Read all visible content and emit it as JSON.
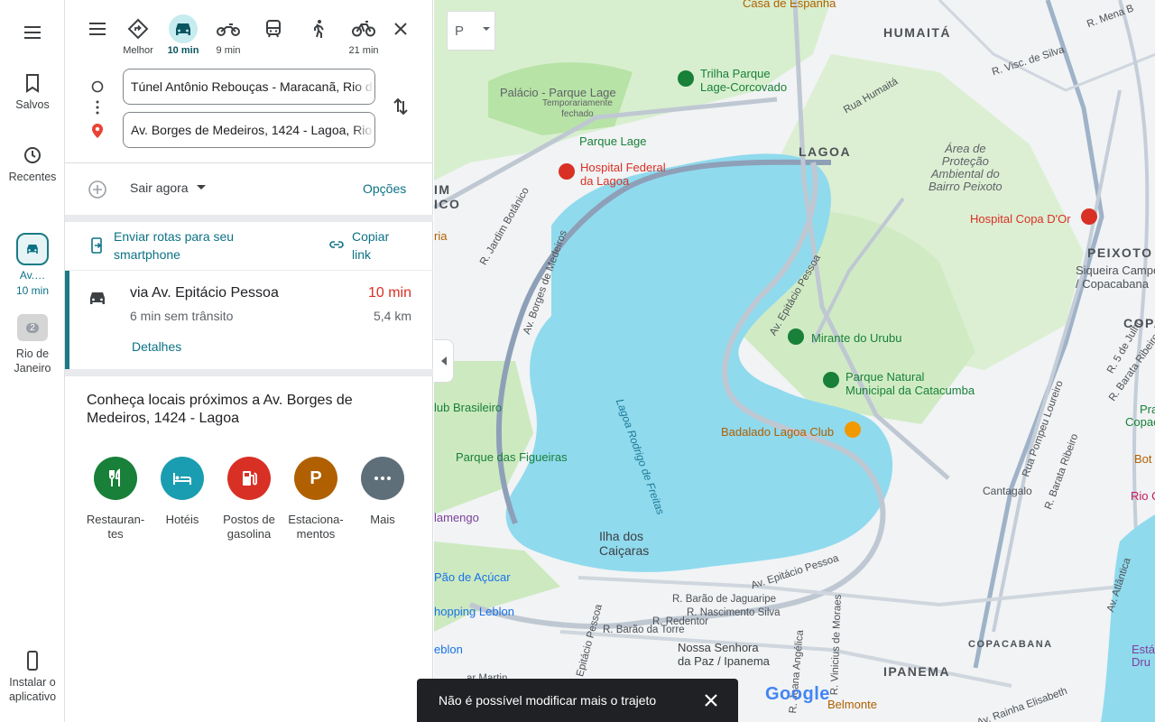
{
  "rail": {
    "saved": "Salvos",
    "recents": "Recentes",
    "route_label": "Av.…",
    "route_time": "10 min",
    "place_label_1": "Rio de",
    "place_label_2": "Janeiro",
    "place_count": "2",
    "install_1": "Instalar o",
    "install_2": "aplicativo"
  },
  "modes": [
    {
      "name": "best",
      "label": "Melhor"
    },
    {
      "name": "car",
      "label": "10 min"
    },
    {
      "name": "moto",
      "label": "9 min"
    },
    {
      "name": "transit",
      "label": ""
    },
    {
      "name": "walk",
      "label": ""
    },
    {
      "name": "bike",
      "label": "21 min"
    }
  ],
  "directions": {
    "origin": "Túnel Antônio Rebouças - Maracanã, Rio de Janeiro",
    "destination": "Av. Borges de Medeiros, 1424 - Lagoa, Rio de Janeiro"
  },
  "leave": {
    "label": "Sair agora",
    "options": "Opções"
  },
  "share": {
    "send_1": "Enviar rotas para seu",
    "send_2": "smartphone",
    "copy_1": "Copiar",
    "copy_2": "link"
  },
  "route": {
    "via": "via Av. Epitácio Pessoa",
    "time": "10 min",
    "traffic": "6 min sem trânsito",
    "distance": "5,4 km",
    "details": "Detalhes"
  },
  "nearby": {
    "title_1": "Conheça locais próximos a Av. Borges de",
    "title_2": "Medeiros, 1424 - Lagoa",
    "categories": [
      {
        "l1": "Restauran-",
        "l2": "tes"
      },
      {
        "l1": "Hotéis",
        "l2": ""
      },
      {
        "l1": "Postos de",
        "l2": "gasolina"
      },
      {
        "l1": "Estaciona-",
        "l2": "mentos"
      },
      {
        "l1": "Mais",
        "l2": ""
      }
    ]
  },
  "map": {
    "layer_label": "P",
    "labels": {
      "humaita": "HUMAITÁ",
      "lagoa": "LAGOA",
      "peixoto": "PEIXOTO",
      "copa": "COPA",
      "copacabana": "COPACABANA",
      "ipanema": "IPANEMA",
      "im": "IM",
      "ico": "ICO",
      "casa": "Casa de Espanha",
      "trilha_1": "Trilha Parque",
      "trilha_2": "Lage-Corcovado",
      "palacio": "Palácio - Parque Lage",
      "temp_1": "Temporariamente",
      "temp_2": "fechado",
      "parque_lage": "Parque Lage",
      "hospital_fed_1": "Hospital Federal",
      "hospital_fed_2": "da Lagoa",
      "area_1": "Área de",
      "area_2": "Proteção",
      "area_3": "Ambiental do",
      "area_4": "Bairro Peixoto",
      "hospital_copa": "Hospital Copa D'Or",
      "siqueira_1": "Siqueira Campos",
      "siqueira_2": "/ Copacabana",
      "mirante": "Mirante do Urubu",
      "parque_natural_1": "Parque Natural",
      "parque_natural_2": "Municipal da Catacumba",
      "badalado": "Badalado Lagoa Club",
      "cantagalo": "Cantagalo",
      "club": "lub Brasileiro",
      "figueiras": "Parque das Figueiras",
      "lagoa_rf": "Lagoa Rodrigo de Freitas",
      "ilha_1": "Ilha dos",
      "ilha_2": "Caiçaras",
      "flamengo": "lamengo",
      "pao": "Pão de Açúcar",
      "shopping": "hopping Leblon",
      "eblon": "eblon",
      "nossa_1": "Nossa Senhora",
      "nossa_2": "da Paz / Ipanema",
      "belmonte": "Belmonte",
      "ria": "ria",
      "pra": "Pra",
      "copaca": "Copaca",
      "bot": "Bot",
      "rio": "Rio C",
      "esta": "Está",
      "dru": "Dru",
      "st_humaita": "Rua Humaitá",
      "st_visc": "R. Visc. de Silva",
      "st_mena": "R. Mena B",
      "st_jardim": "R. Jardim Botânico",
      "st_borges": "Av. Borges de Medeiros",
      "st_epitacio": "Av. Epitácio Pessoa",
      "st_epitacio2": "Av. Epitácio Pessoa",
      "st_pompeu": "Rua Pompeu Loureiro",
      "st_barata": "R. Barata Ribeiro",
      "st_barata2": "R. Barata Ribeiro",
      "st_julho": "R. 5 de Julho",
      "st_jaguaripe": "R. Barão de Jaguaripe",
      "st_nascimento": "R. Nascimento Silva",
      "st_redentor": "R. Redentor",
      "st_torre": "R. Barão da Torre",
      "st_epitacio3": "Epitácio Pessoa",
      "st_joana": "R. Joana Angélica",
      "st_vinicius": "R. Vinicius de Moraes",
      "st_rainha": "Av. Rainha Elisabeth",
      "st_atlantica": "Av. Atlântica",
      "st_martin": "ar Martin"
    },
    "google": "Google"
  },
  "toast": {
    "text": "Não é possível modificar mais o trajeto"
  },
  "colors": {
    "teal": "#0b7285",
    "red_time": "#d93025",
    "water": "#90daee",
    "park": "#c3ecb2"
  }
}
